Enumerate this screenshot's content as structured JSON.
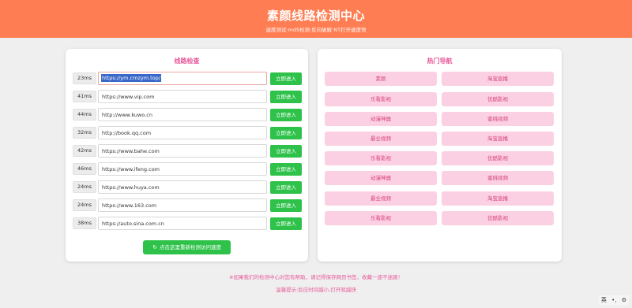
{
  "header": {
    "title": "素颜线路检测中心",
    "subtitle": "速度测试·md5检测·反向破解·NT打开速度快"
  },
  "check": {
    "title": "线路检查",
    "button_label": "立即进入",
    "rows": [
      {
        "ms": "23ms",
        "url": "https://ym.cmzym.top/"
      },
      {
        "ms": "41ms",
        "url": "https://www.vip.com"
      },
      {
        "ms": "44ms",
        "url": "http://www.kuwo.cn"
      },
      {
        "ms": "32ms",
        "url": "http://book.qq.com"
      },
      {
        "ms": "42ms",
        "url": "https://www.bahe.com"
      },
      {
        "ms": "46ms",
        "url": "https://www.ifeng.com"
      },
      {
        "ms": "24ms",
        "url": "https://www.huya.com"
      },
      {
        "ms": "24ms",
        "url": "https://www.163.com"
      },
      {
        "ms": "38ms",
        "url": "https://auto.sina.com.cn"
      }
    ],
    "redetect_label": "点击这里重新检测访问速度",
    "redetect_icon": "refresh-icon"
  },
  "nav": {
    "title": "热门导航",
    "items": [
      "素颜",
      "淘宝直播",
      "乐看影视",
      "优酷影视",
      "动漫神器",
      "蜜桃视频",
      "最全视频",
      "淘宝直播",
      "乐看影视",
      "优酷影视",
      "动漫神器",
      "蜜桃视频",
      "最全视频",
      "淘宝直播",
      "乐看影视",
      "优酷影视"
    ]
  },
  "footer": {
    "line1": "※如果我们的检测中心对您有帮助，请记得保存网页书签，收藏一波不迷路！",
    "line2": "温馨提示:反应时间越小,打开就越快"
  },
  "ime": {
    "lang": "英",
    "punct": "•,",
    "settings_icon": "gear-icon"
  },
  "colors": {
    "header_bg": "#ff7d52",
    "accent_pink": "#e8589a",
    "button_green": "#2ec24a",
    "nav_bg": "#fbd0e2"
  }
}
